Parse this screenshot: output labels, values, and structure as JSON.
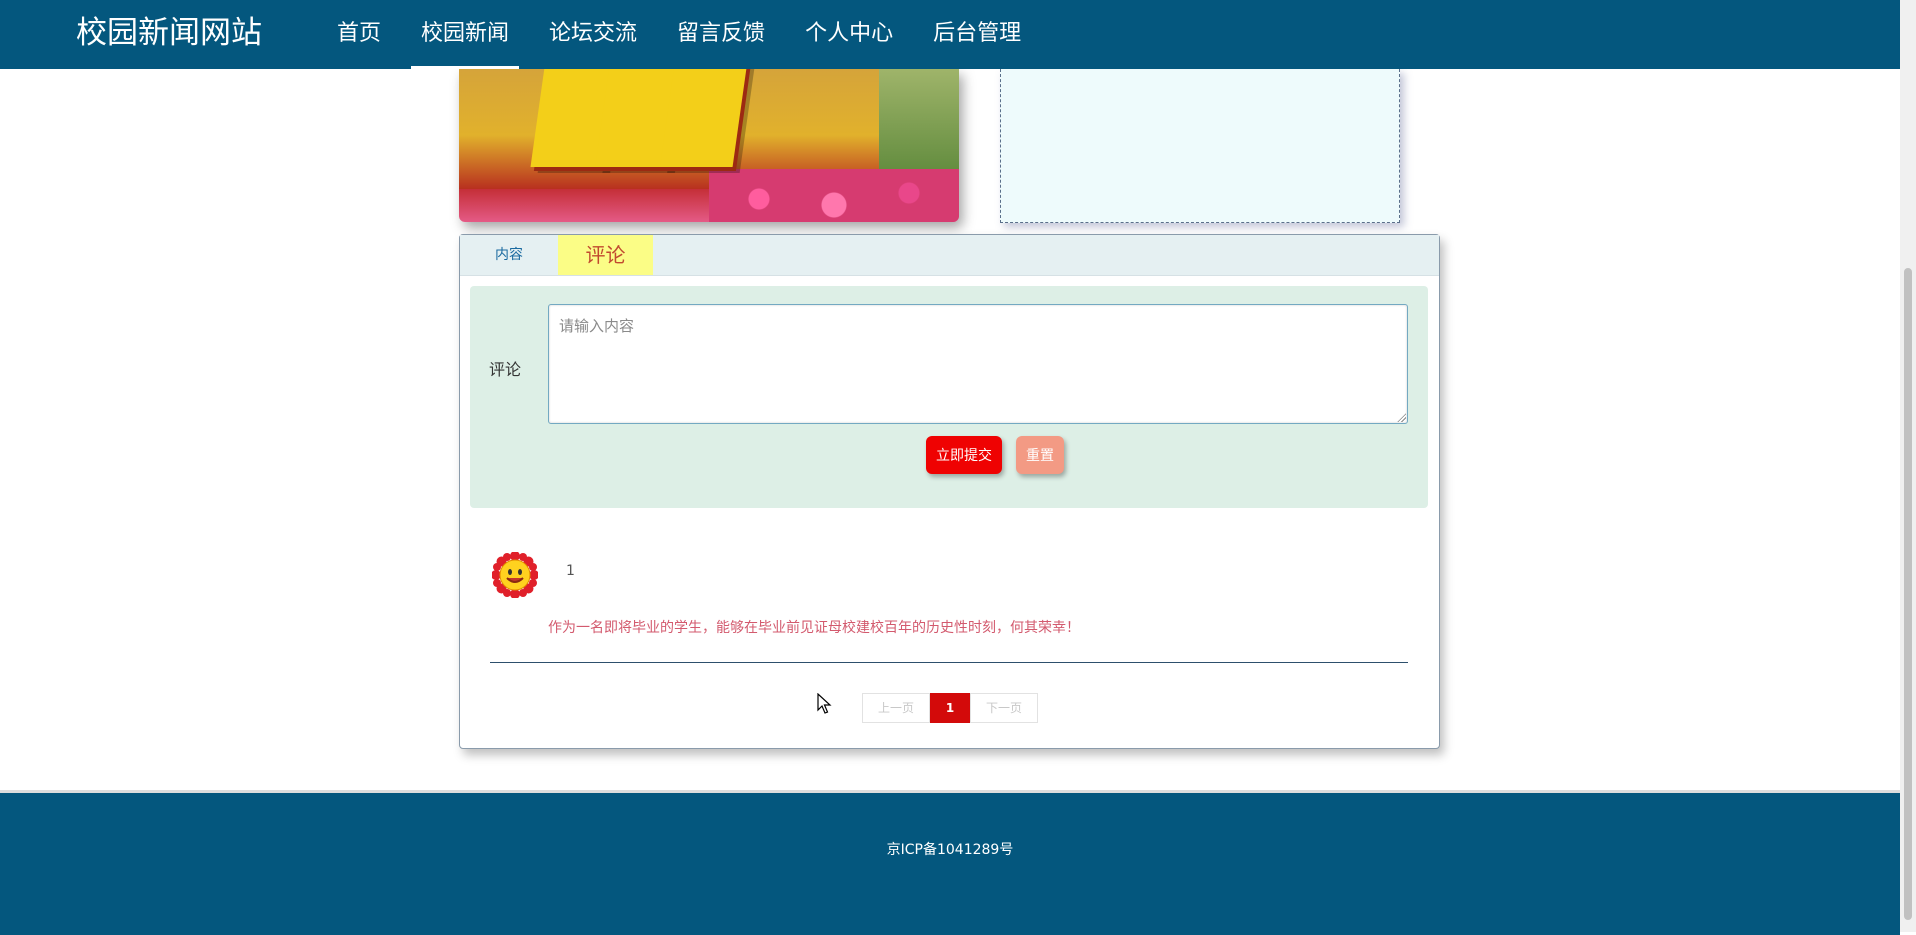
{
  "header": {
    "site_title": "校园新闻网站",
    "nav": [
      {
        "label": "首页",
        "active": false
      },
      {
        "label": "校园新闻",
        "active": true
      },
      {
        "label": "论坛交流",
        "active": false
      },
      {
        "label": "留言反馈",
        "active": false
      },
      {
        "label": "个人中心",
        "active": false
      },
      {
        "label": "后台管理",
        "active": false
      }
    ]
  },
  "tabs": {
    "content_label": "内容",
    "comment_label": "评论",
    "active": "评论"
  },
  "comment_form": {
    "label": "评论",
    "placeholder": "请输入内容",
    "value": "",
    "submit_label": "立即提交",
    "reset_label": "重置"
  },
  "comments": [
    {
      "avatar_icon": "sunflower-smiley-icon",
      "user": "1",
      "text": "作为一名即将毕业的学生，能够在毕业前见证母校建校百年的历史性时刻，何其荣幸！"
    }
  ],
  "pagination": {
    "prev_label": "上一页",
    "current_page": "1",
    "next_label": "下一页"
  },
  "footer": {
    "icp": "京ICP备1041289号"
  },
  "colors": {
    "header_bg": "#04577e",
    "submit_button": "#ef0202",
    "reset_button": "#f39a84",
    "active_tab": "#fbfd86",
    "current_page": "#d30a0a"
  }
}
